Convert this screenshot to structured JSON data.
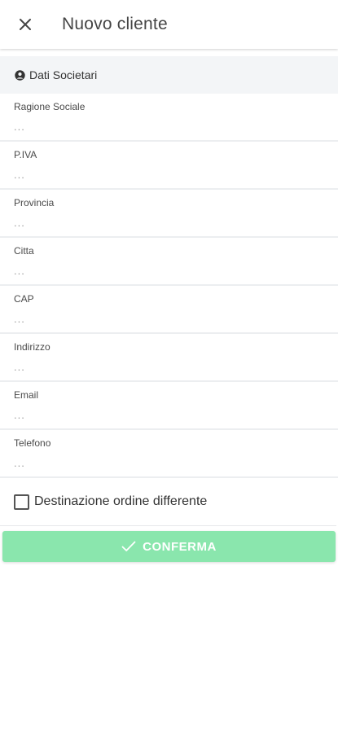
{
  "header": {
    "title": "Nuovo cliente",
    "close_icon": "close-icon"
  },
  "section": {
    "title": "Dati Societari",
    "icon": "user-icon"
  },
  "fields": [
    {
      "label": "Ragione Sociale",
      "value": "",
      "placeholder": "..."
    },
    {
      "label": "P.IVA",
      "value": "",
      "placeholder": "..."
    },
    {
      "label": "Provincia",
      "value": "",
      "placeholder": "..."
    },
    {
      "label": "Citta",
      "value": "",
      "placeholder": "..."
    },
    {
      "label": "CAP",
      "value": "",
      "placeholder": "..."
    },
    {
      "label": "Indirizzo",
      "value": "",
      "placeholder": "..."
    },
    {
      "label": "Email",
      "value": "",
      "placeholder": "..."
    },
    {
      "label": "Telefono",
      "value": "",
      "placeholder": "..."
    }
  ],
  "checkbox": {
    "label": "Destinazione ordine differente",
    "checked": false
  },
  "confirm": {
    "label": "CONFERMA",
    "icon": "check-icon",
    "color": "#8ae6ad"
  }
}
